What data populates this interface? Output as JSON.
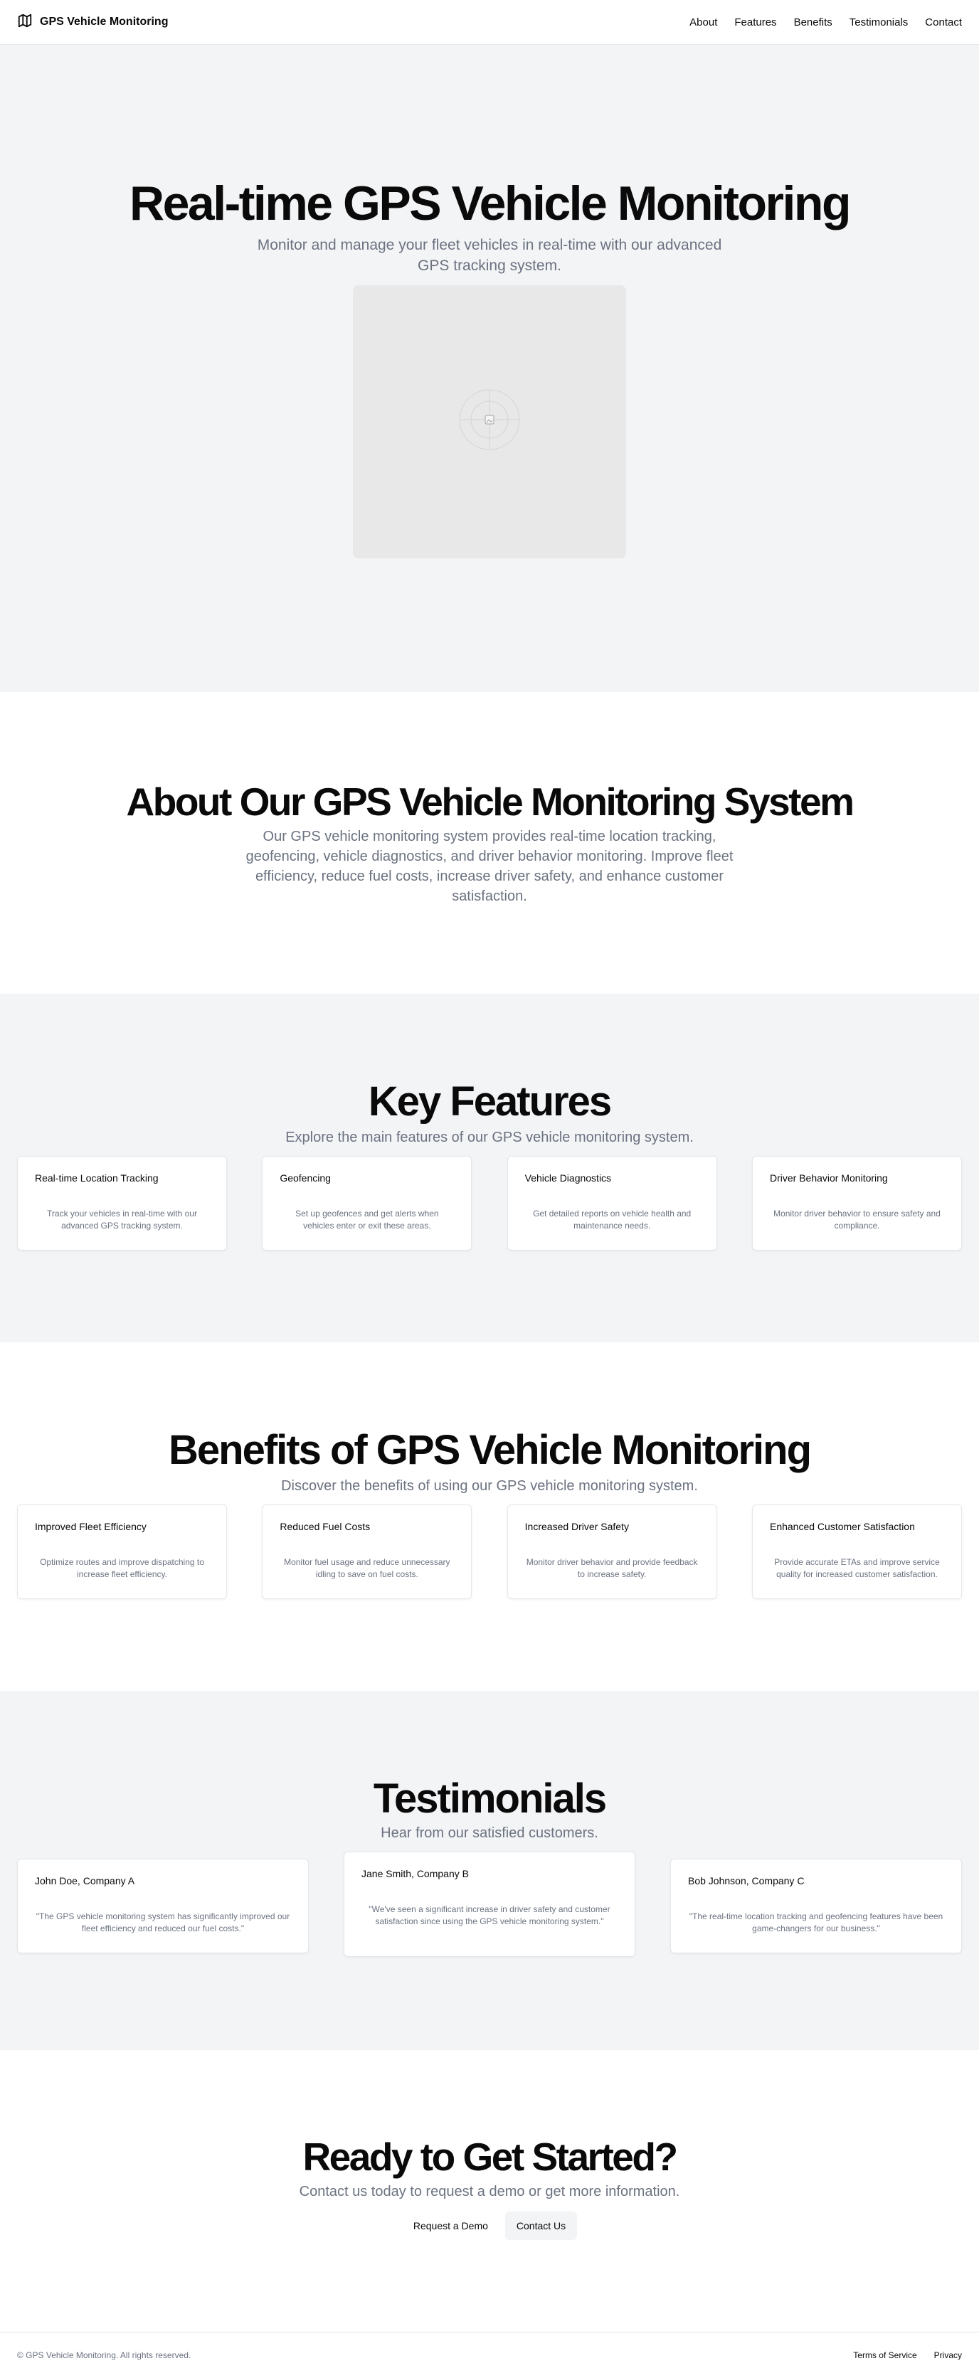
{
  "header": {
    "brand": "GPS Vehicle Monitoring",
    "brand_icon": "map-icon",
    "nav": [
      "About",
      "Features",
      "Benefits",
      "Testimonials",
      "Contact"
    ]
  },
  "hero": {
    "title": "Real-time GPS Vehicle Monitoring",
    "subtitle": "Monitor and manage your fleet vehicles in real-time with our advanced GPS tracking system.",
    "image_icon": "image-placeholder-icon"
  },
  "about": {
    "title": "About Our GPS Vehicle Monitoring System",
    "text": "Our GPS vehicle monitoring system provides real-time location tracking, geofencing, vehicle diagnostics, and driver behavior monitoring. Improve fleet efficiency, reduce fuel costs, increase driver safety, and enhance customer satisfaction."
  },
  "features": {
    "title": "Key Features",
    "subtitle": "Explore the main features of our GPS vehicle monitoring system.",
    "items": [
      {
        "title": "Real-time Location Tracking",
        "desc": "Track your vehicles in real-time with our advanced GPS tracking system."
      },
      {
        "title": "Geofencing",
        "desc": "Set up geofences and get alerts when vehicles enter or exit these areas."
      },
      {
        "title": "Vehicle Diagnostics",
        "desc": "Get detailed reports on vehicle health and maintenance needs."
      },
      {
        "title": "Driver Behavior Monitoring",
        "desc": "Monitor driver behavior to ensure safety and compliance."
      }
    ]
  },
  "benefits": {
    "title": "Benefits of GPS Vehicle Monitoring",
    "subtitle": "Discover the benefits of using our GPS vehicle monitoring system.",
    "items": [
      {
        "title": "Improved Fleet Efficiency",
        "desc": "Optimize routes and improve dispatching to increase fleet efficiency."
      },
      {
        "title": "Reduced Fuel Costs",
        "desc": "Monitor fuel usage and reduce unnecessary idling to save on fuel costs."
      },
      {
        "title": "Increased Driver Safety",
        "desc": "Monitor driver behavior and provide feedback to increase safety."
      },
      {
        "title": "Enhanced Customer Satisfaction",
        "desc": "Provide accurate ETAs and improve service quality for increased customer satisfaction."
      }
    ]
  },
  "testimonials": {
    "title": "Testimonials",
    "subtitle": "Hear from our satisfied customers.",
    "items": [
      {
        "name": "John Doe, Company A",
        "quote": "\"The GPS vehicle monitoring system has significantly improved our fleet efficiency and reduced our fuel costs.\""
      },
      {
        "name": "Jane Smith, Company B",
        "quote": "\"We've seen a significant increase in driver safety and customer satisfaction since using the GPS vehicle monitoring system.\""
      },
      {
        "name": "Bob Johnson, Company C",
        "quote": "\"The real-time location tracking and geofencing features have been game-changers for our business.\""
      }
    ]
  },
  "cta": {
    "title": "Ready to Get Started?",
    "subtitle": "Contact us today to request a demo or get more information.",
    "primary": "Request a Demo",
    "secondary": "Contact Us"
  },
  "footer": {
    "copyright": "© GPS Vehicle Monitoring. All rights reserved.",
    "links": [
      "Terms of Service",
      "Privacy"
    ]
  }
}
